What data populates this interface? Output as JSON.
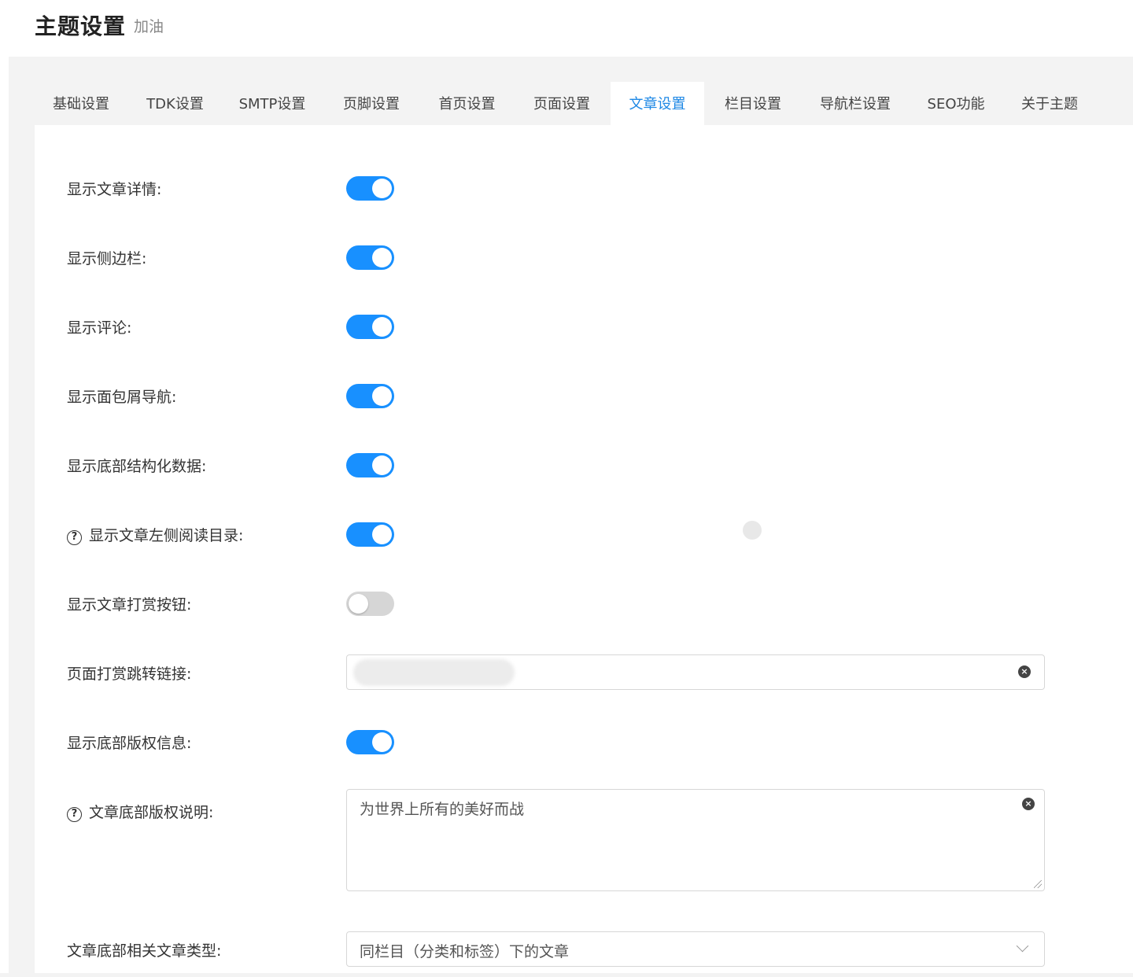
{
  "header": {
    "title": "主题设置",
    "subtitle": "加油"
  },
  "tabs": [
    {
      "label": "基础设置"
    },
    {
      "label": "TDK设置"
    },
    {
      "label": "SMTP设置"
    },
    {
      "label": "页脚设置"
    },
    {
      "label": "首页设置"
    },
    {
      "label": "页面设置"
    },
    {
      "label": "文章设置",
      "active": true
    },
    {
      "label": "栏目设置"
    },
    {
      "label": "导航栏设置"
    },
    {
      "label": "SEO功能"
    },
    {
      "label": "关于主题"
    }
  ],
  "settings": {
    "show_detail": {
      "label": "显示文章详情:",
      "on": true
    },
    "show_sidebar": {
      "label": "显示侧边栏:",
      "on": true
    },
    "show_comments": {
      "label": "显示评论:",
      "on": true
    },
    "show_breadcrumb": {
      "label": "显示面包屑导航:",
      "on": true
    },
    "show_structured_data": {
      "label": "显示底部结构化数据:",
      "on": true
    },
    "show_toc": {
      "label": "显示文章左侧阅读目录:",
      "on": true,
      "help": "?"
    },
    "show_reward_button": {
      "label": "显示文章打赏按钮:",
      "on": false
    },
    "reward_link": {
      "label": "页面打赏跳转链接:",
      "value": ""
    },
    "show_copyright": {
      "label": "显示底部版权信息:",
      "on": true
    },
    "copyright_text": {
      "label": "文章底部版权说明:",
      "value": "为世界上所有的美好而战",
      "help": "?"
    },
    "related_type": {
      "label": "文章底部相关文章类型:",
      "value": "同栏目（分类和标签）下的文章"
    }
  },
  "icons": {
    "clear": "clear-circle-icon",
    "help": "question-circle-icon",
    "dropdown": "chevron-down-icon"
  },
  "colors": {
    "accent": "#1890ff",
    "active_tab_text": "#1e88e5",
    "toggle_off": "#d6d6d6",
    "background": "#f3f3f3"
  }
}
